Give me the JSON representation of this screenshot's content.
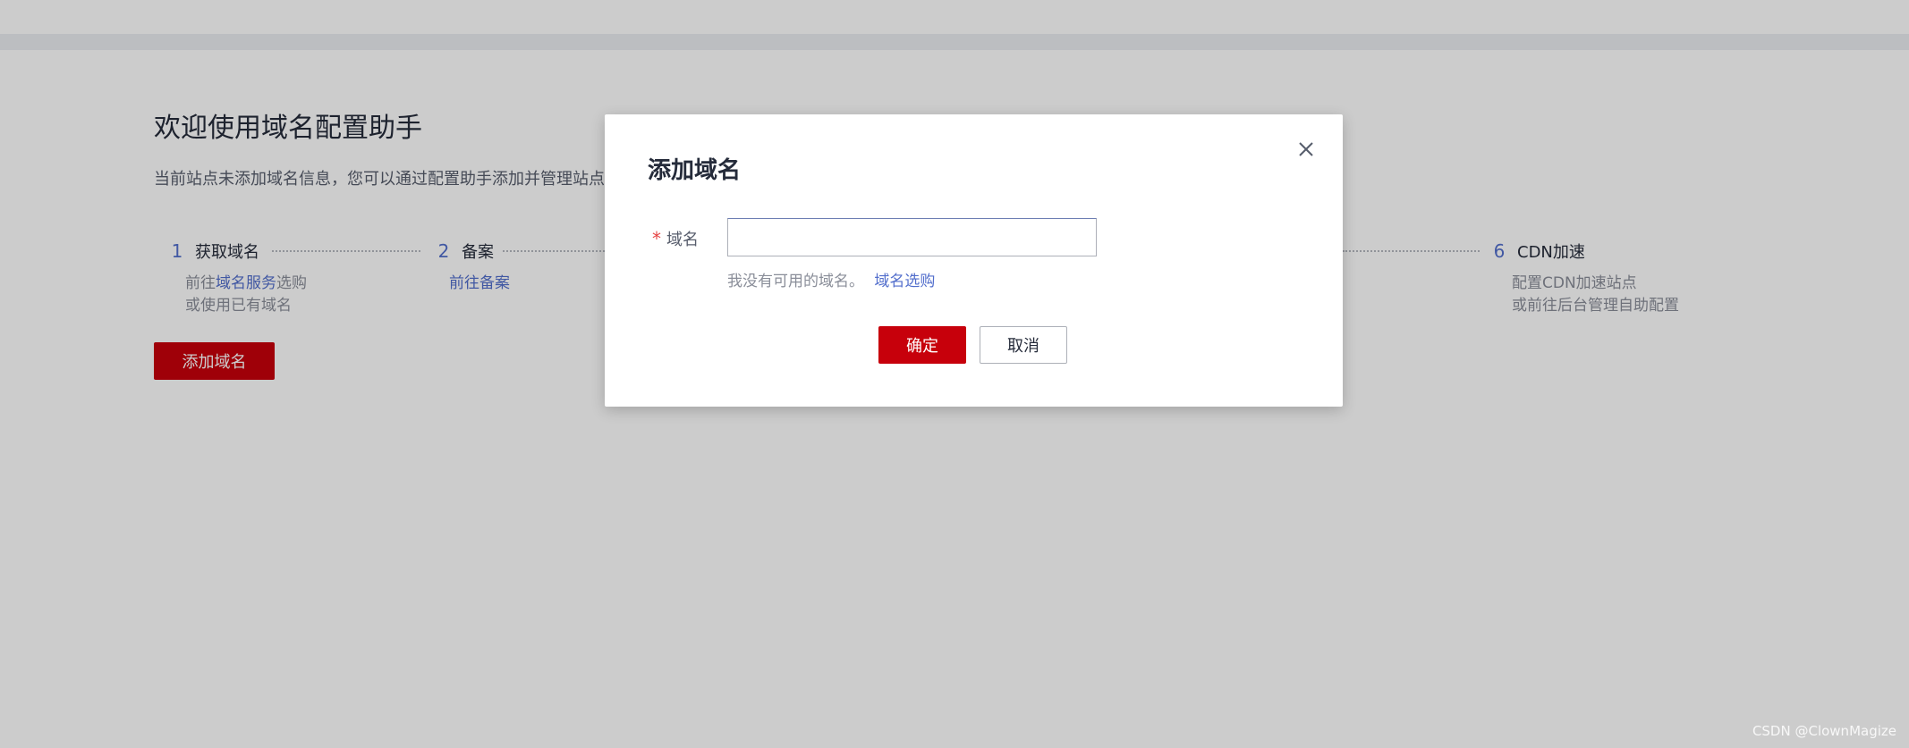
{
  "page": {
    "title": "欢迎使用域名配置助手",
    "description": "当前站点未添加域名信息，您可以通过配置助手添加并管理站点",
    "add_domain_button": "添加域名"
  },
  "steps": [
    {
      "number": "1",
      "title": "获取域名",
      "desc_prefix": "前往",
      "desc_link": "域名服务",
      "desc_suffix": "选购",
      "desc_line2": "或使用已有域名"
    },
    {
      "number": "2",
      "title": "备案",
      "desc_link": "前往备案"
    },
    {
      "number": "6",
      "title": "CDN加速",
      "desc_line1": "配置CDN加速站点",
      "desc_line2": "或前往后台管理自助配置"
    }
  ],
  "modal": {
    "title": "添加域名",
    "field_label": "域名",
    "required_mark": "*",
    "input_value": "",
    "hint_text": "我没有可用的域名。",
    "hint_link": "域名选购",
    "confirm": "确定",
    "cancel": "取消"
  },
  "watermark": "CSDN @ClownMagize",
  "colors": {
    "accent": "#c7000b",
    "link": "#526ecc"
  }
}
